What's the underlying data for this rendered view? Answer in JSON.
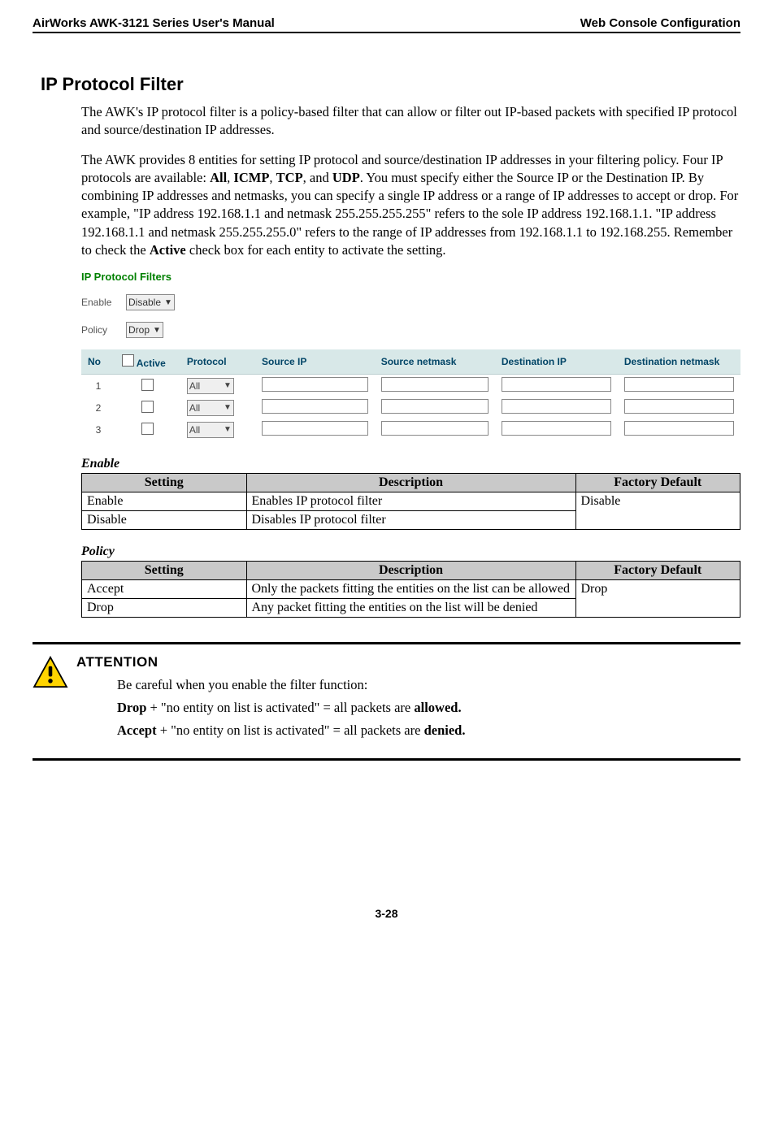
{
  "header": {
    "left": "AirWorks AWK-3121 Series User's Manual",
    "right": "Web Console Configuration"
  },
  "section_title": "IP Protocol Filter",
  "para1": "The AWK's IP protocol filter is a policy-based filter that can allow or filter out IP-based packets with specified IP protocol and source/destination IP addresses.",
  "para2_parts": {
    "a": "The AWK provides 8 entities for setting IP protocol and source/destination IP addresses in your filtering policy. Four IP protocols are available: ",
    "b_all": "All",
    "c": ", ",
    "d_icmp": "ICMP",
    "e": ", ",
    "f_tcp": "TCP",
    "g": ", and ",
    "h_udp": "UDP",
    "i": ". You must specify either the Source IP or the Destination IP. By combining IP addresses and netmasks, you can specify a single IP address or a range of IP addresses to accept or drop. For example, \"IP address 192.168.1.1 and netmask 255.255.255.255\" refers to the sole IP address 192.168.1.1. \"IP address 192.168.1.1 and netmask 255.255.255.0\" refers to the range of IP addresses from 192.168.1.1 to 192.168.255. Remember to check the ",
    "j_active": "Active",
    "k": " check box for each entity to activate the setting."
  },
  "ui": {
    "title": "IP Protocol Filters",
    "enable_label": "Enable",
    "enable_value": "Disable",
    "policy_label": "Policy",
    "policy_value": "Drop",
    "columns": {
      "no": "No",
      "active": "Active",
      "protocol": "Protocol",
      "src_ip": "Source IP",
      "src_mask": "Source netmask",
      "dst_ip": "Destination IP",
      "dst_mask": "Destination netmask"
    },
    "rows": [
      {
        "no": "1",
        "protocol": "All"
      },
      {
        "no": "2",
        "protocol": "All"
      },
      {
        "no": "3",
        "protocol": "All"
      }
    ]
  },
  "enable_heading": "Enable",
  "enable_table": {
    "headers": {
      "setting": "Setting",
      "desc": "Description",
      "def": "Factory Default"
    },
    "rows": [
      {
        "setting": "Enable",
        "desc": "Enables IP protocol filter"
      },
      {
        "setting": "Disable",
        "desc": "Disables IP protocol filter"
      }
    ],
    "default": "Disable"
  },
  "policy_heading": "Policy",
  "policy_table": {
    "headers": {
      "setting": "Setting",
      "desc": "Description",
      "def": "Factory Default"
    },
    "rows": [
      {
        "setting": "Accept",
        "desc": "Only the packets fitting the entities on the list can be allowed"
      },
      {
        "setting": "Drop",
        "desc": "Any packet fitting the entities on the list will be denied"
      }
    ],
    "default": "Drop"
  },
  "attention": {
    "title": "ATTENTION",
    "line1": "Be careful when you enable the filter function:",
    "line2_parts": {
      "a": "Drop",
      "b": " + \"no entity on list is activated\" = all packets are ",
      "c": "allowed.",
      "d": ""
    },
    "line3_parts": {
      "a": "Accept",
      "b": " + \"no entity on list is activated\" = all packets are ",
      "c": "denied.",
      "d": ""
    }
  },
  "page_number": "3-28"
}
